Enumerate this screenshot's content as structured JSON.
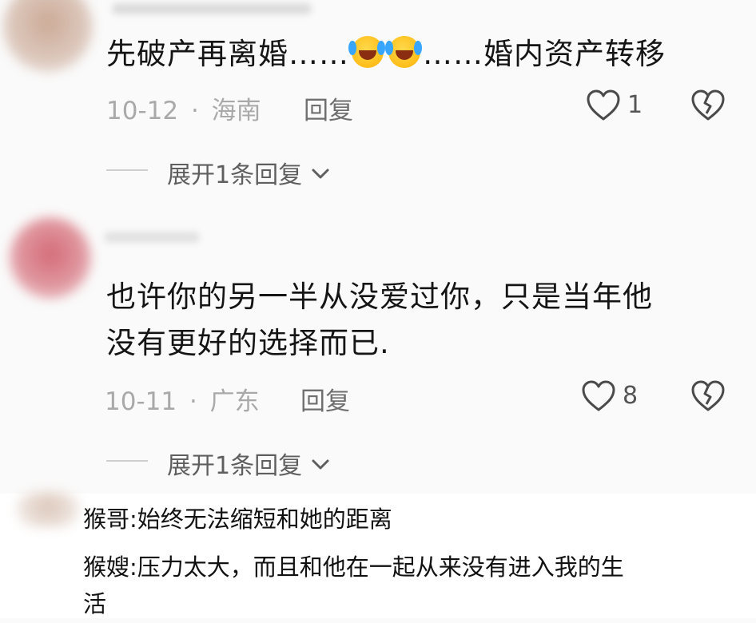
{
  "comments": [
    {
      "text_parts": [
        "先破产再离婚……",
        "……婚内资产转移"
      ],
      "emoji_count": 2,
      "date": "10-12",
      "separator": "·",
      "region": "海南",
      "reply_label": "回复",
      "likes": "1",
      "expand_label": "展开1条回复"
    },
    {
      "text_lines": [
        "也许你的另一半从没爱过你，只是当年他",
        "没有更好的选择而已."
      ],
      "date": "10-11",
      "separator": "·",
      "region": "广东",
      "reply_label": "回复",
      "likes": "8",
      "expand_label": "展开1条回复"
    }
  ],
  "quote": {
    "lines": [
      "猴哥:始终无法缩短和她的距离",
      "猴嫂:压力太大，而且和他在一起从来没有进入我的生",
      "活"
    ]
  },
  "colors": {
    "background": "#fafafa",
    "text": "#151515",
    "meta": "#a9a9a9",
    "icon": "#4a4a4a"
  },
  "icons": {
    "like": "heart-outline-icon",
    "dislike": "broken-heart-icon",
    "expand": "chevron-down-icon",
    "emoji": "laughing-crying-emoji"
  }
}
